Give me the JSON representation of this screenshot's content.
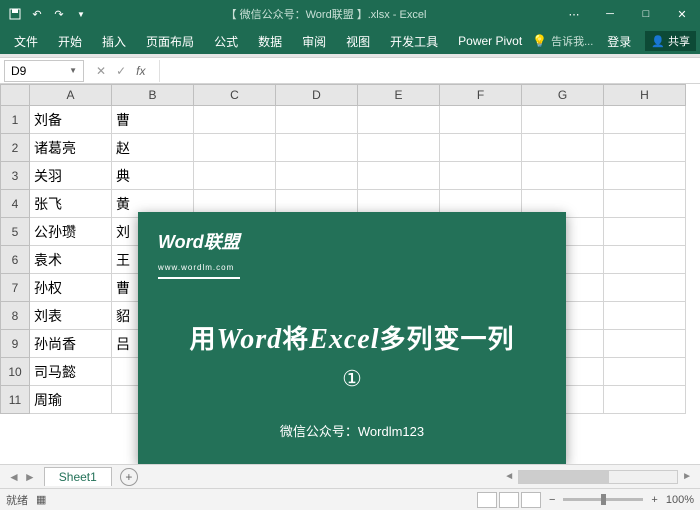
{
  "title": "【 微信公众号：Word联盟 】.xlsx - Excel",
  "qat": {
    "save": "save",
    "undo": "undo",
    "redo": "redo"
  },
  "tabs": {
    "file": "文件",
    "home": "开始",
    "insert": "插入",
    "layout": "页面布局",
    "formulas": "公式",
    "data": "数据",
    "review": "审阅",
    "view": "视图",
    "dev": "开发工具",
    "pivot": "Power Pivot"
  },
  "tellme": "告诉我...",
  "login": "登录",
  "share": "共享",
  "namebox": "D9",
  "fx": "fx",
  "columns": [
    "A",
    "B",
    "C",
    "D",
    "E",
    "F",
    "G",
    "H"
  ],
  "rows": [
    "1",
    "2",
    "3",
    "4",
    "5",
    "6",
    "7",
    "8",
    "9",
    "10",
    "11"
  ],
  "cells": {
    "A": [
      "刘备",
      "诸葛亮",
      "关羽",
      "张飞",
      "公孙瓒",
      "袁术",
      "孙权",
      "刘表",
      "孙尚香",
      "司马懿",
      "周瑜"
    ],
    "B": [
      "曹",
      "赵",
      "典",
      "黄",
      "刘",
      "王",
      "曹",
      "貂",
      "吕",
      "",
      ""
    ]
  },
  "overlay": {
    "logo": "Word联盟",
    "logo_sub": "www.wordlm.com",
    "prefix": "用",
    "w1": "Word",
    "mid": "将",
    "w2": "Excel",
    "suffix": "多列变一列",
    "circle": "①",
    "footer": "微信公众号：Wordlm123"
  },
  "sheet": {
    "name": "Sheet1",
    "add": "+"
  },
  "status": {
    "ready": "就绪",
    "zoom": "100%",
    "plus": "+",
    "minus": "−"
  }
}
